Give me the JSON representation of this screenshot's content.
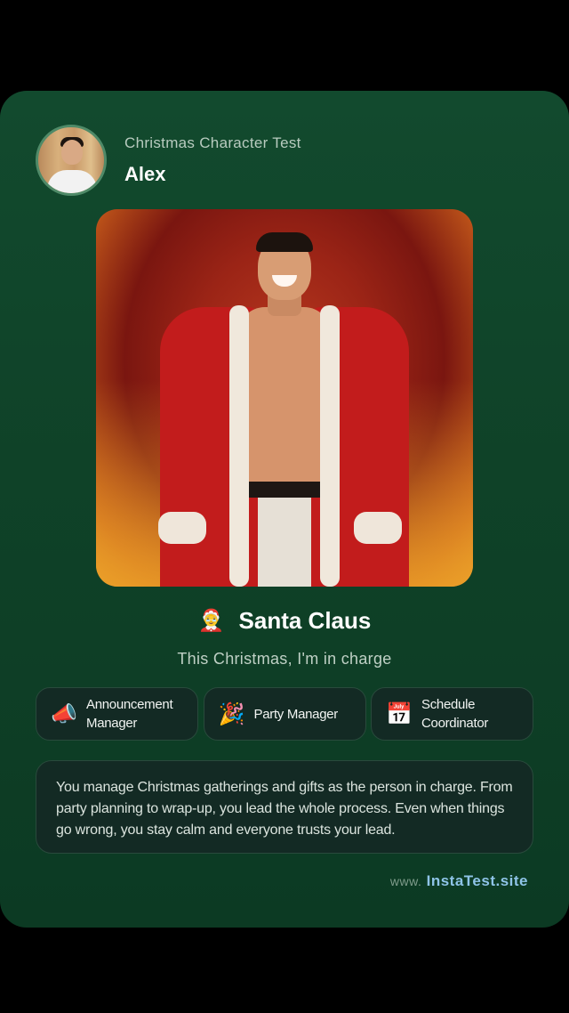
{
  "header": {
    "subtitle": "Christmas Character Test",
    "username": "Alex",
    "avatar_icon": "user-photo"
  },
  "result": {
    "emoji": "🤶",
    "title": "Santa Claus",
    "tagline": "This Christmas, I'm in charge"
  },
  "tags": [
    {
      "icon": "📣",
      "icon_name": "megaphone-icon",
      "label_line1": "Announcement",
      "label_line2": "Manager"
    },
    {
      "icon": "🎉",
      "icon_name": "party-popper-icon",
      "label_line1": "Party Manager",
      "label_line2": ""
    },
    {
      "icon": "📅",
      "icon_name": "calendar-icon",
      "label_line1": "Schedule",
      "label_line2": "Coordinator"
    }
  ],
  "description": "You manage Christmas gatherings and gifts as the person in charge. From party planning to wrap-up, you lead the whole process. Even when things go wrong, you stay calm and everyone trusts your lead.",
  "footer": {
    "site_prefix": "www.",
    "site_name": "InstaTest.site"
  },
  "colors": {
    "card_background": "#0f4228",
    "accent_link": "#8fc4e8",
    "tag_background": "#132a24"
  }
}
